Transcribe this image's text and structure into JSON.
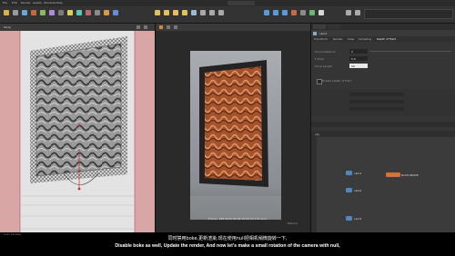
{
  "app": {
    "menu_items": [
      "File",
      "Edit",
      "Render",
      "Assets",
      "Windows",
      "Help"
    ],
    "shelf_tabs": [
      "Create",
      "Modify",
      "Model",
      "Polygon",
      "Deform",
      "Texture",
      "Rigging",
      "Characters",
      "Constraints",
      "Hair Utils",
      "Guide Process",
      "Terrain FX",
      "Simple FX",
      "Volume",
      "Lights and Cameras",
      "Collisions",
      "Particles",
      "Grains",
      "Rigid Bodies",
      "Particle Fluids",
      "Viscous Fluids",
      "Oceans"
    ]
  },
  "viewport_left": {
    "label": "Persp"
  },
  "render_view": {
    "info_text": "Frame: 188  2024-05-06  10:52:47  137 secs",
    "corner_text": "Mantra"
  },
  "parameters": {
    "title": "cam1",
    "tabs": [
      "Transform",
      "Render",
      "View",
      "Sampling",
      "Depth of Field"
    ],
    "rows": [
      {
        "label": "Focus Distance",
        "value": "5"
      },
      {
        "label": "F-Stop",
        "value": "5.6"
      },
      {
        "label": "Focal Length",
        "value": "50"
      },
      {
        "label": "Enable Depth of Field",
        "value": ""
      }
    ]
  },
  "network": {
    "path": "obj",
    "nodes": [
      {
        "label": "cam1",
        "color": "#4f86c6"
      },
      {
        "label": "cam2",
        "color": "#4f86c6"
      },
      {
        "label": "cam3",
        "color": "#4f86c6"
      },
      {
        "label": "NullforNODE",
        "color": "#d8703a"
      }
    ]
  },
  "subtitles": {
    "chinese": "同时禁用boke,更新渲染,现在使用null把相机稍微旋转一下,",
    "english": "Disable boke as well, Update the render, And now let's make a small rotation of the camera with null,"
  },
  "status_text": "Auto Update"
}
